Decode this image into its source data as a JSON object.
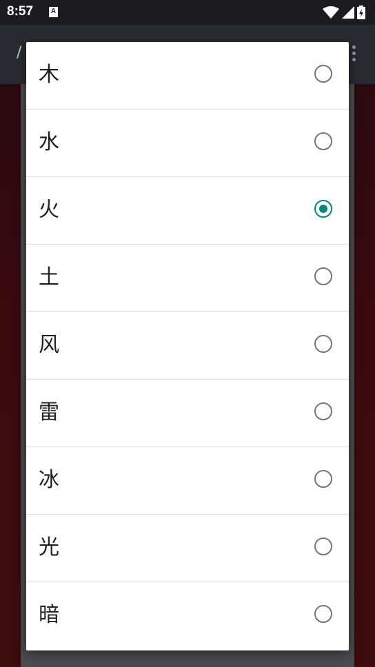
{
  "status_bar": {
    "time": "8:57",
    "notification_icon_text": "A",
    "icons": [
      "wifi-icon",
      "signal-icon",
      "battery-icon"
    ]
  },
  "app_bar": {
    "title": "/"
  },
  "dialog": {
    "selected_index": 2,
    "accent_color": "#00897b",
    "options": [
      {
        "label": "木",
        "checked": false
      },
      {
        "label": "水",
        "checked": false
      },
      {
        "label": "火",
        "checked": true
      },
      {
        "label": "土",
        "checked": false
      },
      {
        "label": "风",
        "checked": false
      },
      {
        "label": "雷",
        "checked": false
      },
      {
        "label": "冰",
        "checked": false
      },
      {
        "label": "光",
        "checked": false
      },
      {
        "label": "暗",
        "checked": false
      }
    ]
  }
}
